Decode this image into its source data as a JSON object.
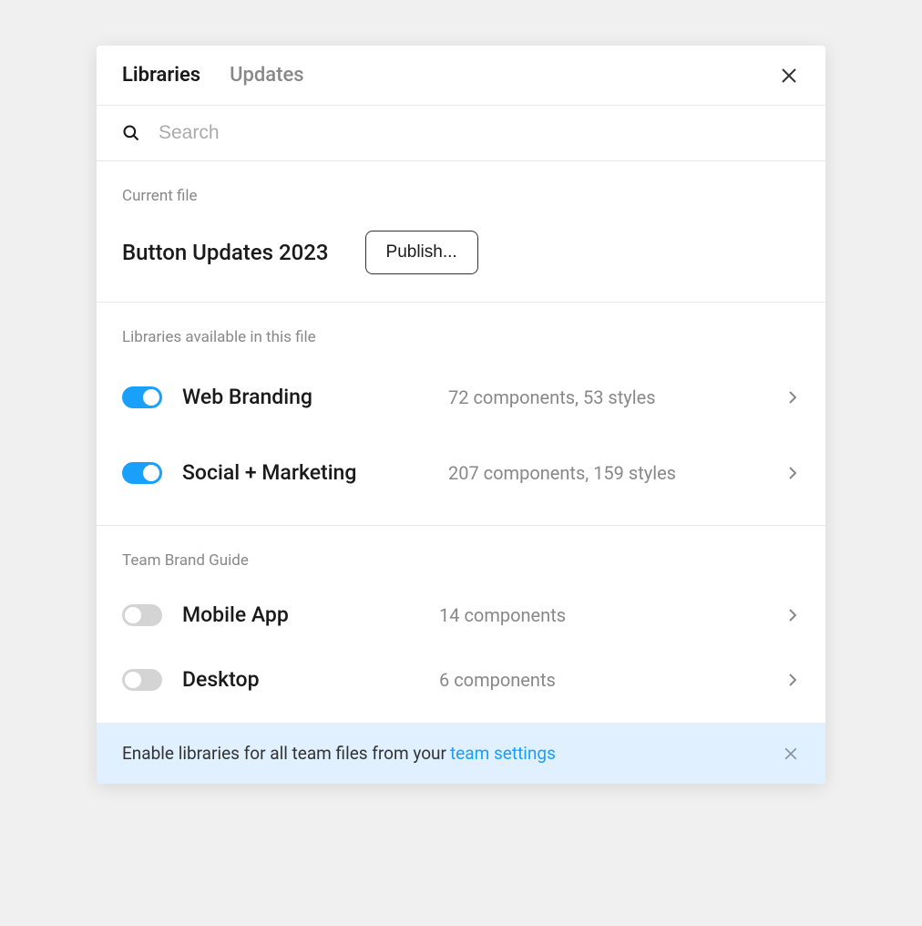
{
  "header": {
    "tabs": [
      {
        "label": "Libraries",
        "active": true
      },
      {
        "label": "Updates",
        "active": false
      }
    ]
  },
  "search": {
    "placeholder": "Search"
  },
  "current_file": {
    "section_label": "Current file",
    "name": "Button Updates 2023",
    "publish_label": "Publish..."
  },
  "available": {
    "section_label": "Libraries available in this file",
    "items": [
      {
        "name": "Web Branding",
        "meta": "72 components, 53 styles",
        "enabled": true
      },
      {
        "name": "Social + Marketing",
        "meta": "207 components, 159 styles",
        "enabled": true
      }
    ]
  },
  "team": {
    "section_label": "Team Brand Guide",
    "items": [
      {
        "name": "Mobile App",
        "meta": "14 components",
        "enabled": false
      },
      {
        "name": "Desktop",
        "meta": "6 components",
        "enabled": false
      }
    ]
  },
  "footer": {
    "text": "Enable libraries for all team files from your",
    "link_label": "team settings"
  }
}
